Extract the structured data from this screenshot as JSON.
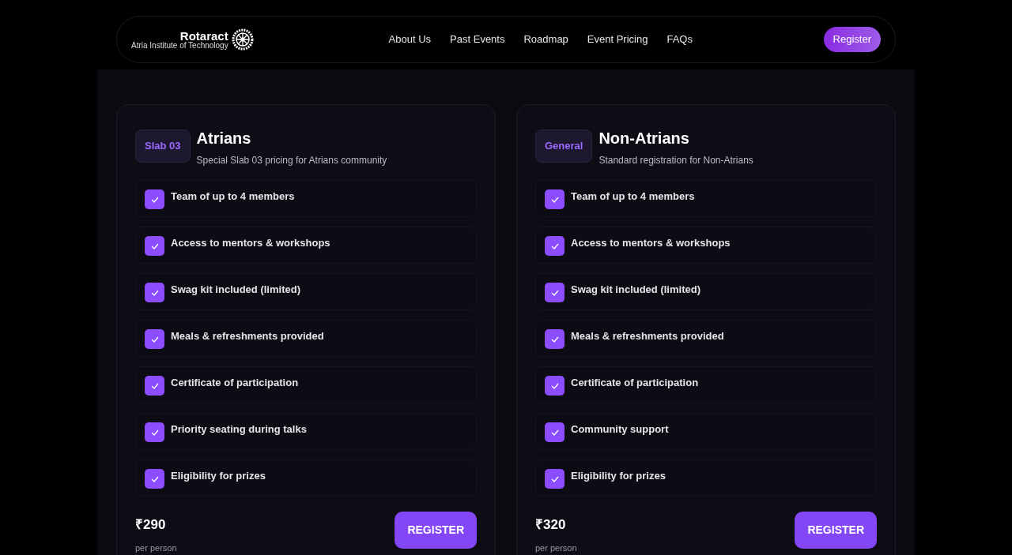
{
  "navbar": {
    "logo_title": "Rotaract",
    "logo_subtitle": "Atria Institute of Technology",
    "links": [
      "About Us",
      "Past Events",
      "Roadmap",
      "Event Pricing",
      "FAQs"
    ],
    "cta": "Register"
  },
  "plans": [
    {
      "badge": "Slab 03",
      "title": "Atrians",
      "subtitle": "Special Slab 03 pricing for Atrians community",
      "features": [
        {
          "label": "Team of up to 4 members",
          "checked": true
        },
        {
          "label": "Access to mentors & workshops",
          "checked": true
        },
        {
          "label": "Swag kit included (limited)",
          "checked": true
        },
        {
          "label": "Meals & refreshments provided",
          "checked": true
        },
        {
          "label": "Certificate of participation",
          "checked": true
        },
        {
          "label": "Priority seating during talks",
          "checked": true
        },
        {
          "label": "Eligibility for prizes",
          "checked": true
        }
      ],
      "price": "₹290",
      "price_unit": "per person",
      "button": "REGISTER"
    },
    {
      "badge": "General",
      "title": "Non-Atrians",
      "subtitle": "Standard registration for Non-Atrians",
      "features": [
        {
          "label": "Team of up to 4 members",
          "checked": true
        },
        {
          "label": "Access to mentors & workshops",
          "checked": true
        },
        {
          "label": "Swag kit included (limited)",
          "checked": true
        },
        {
          "label": "Meals & refreshments provided",
          "checked": true
        },
        {
          "label": "Certificate of participation",
          "checked": true
        },
        {
          "label": "Community support",
          "checked": true
        },
        {
          "label": "Eligibility for prizes",
          "checked": true
        }
      ],
      "price": "₹320",
      "price_unit": "per person",
      "button": "REGISTER"
    }
  ]
}
